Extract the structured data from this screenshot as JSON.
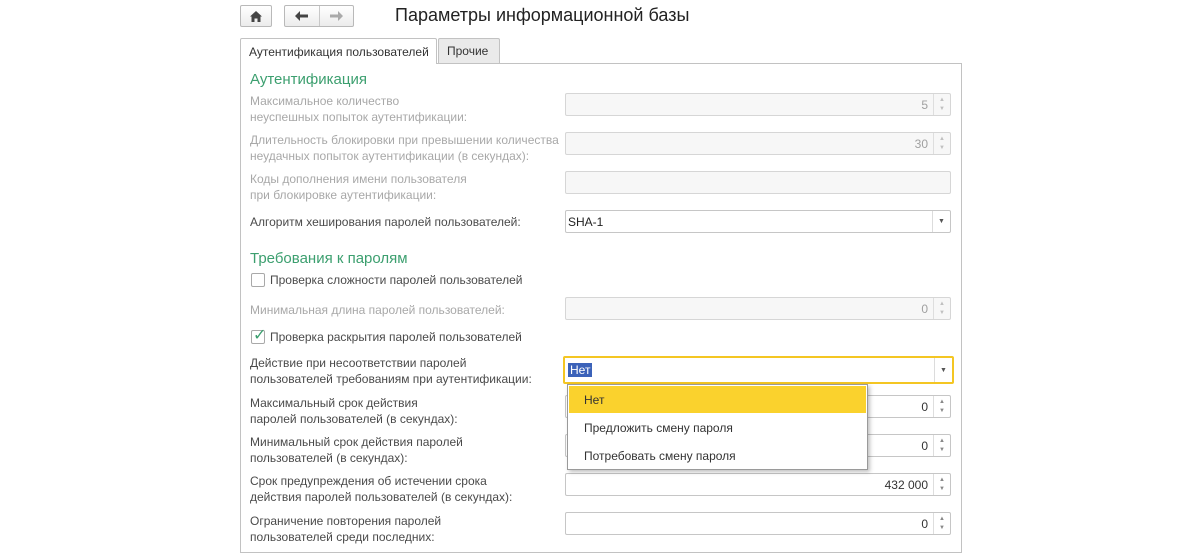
{
  "toolbar": {
    "home_icon": "home-icon",
    "back_icon": "arrow-left-icon",
    "forward_icon": "arrow-right-icon",
    "title": "Параметры информационной базы"
  },
  "tabs": [
    {
      "label": "Аутентификация пользователей",
      "active": true
    },
    {
      "label": "Прочие",
      "active": false
    }
  ],
  "auth_section": {
    "heading": "Аутентификация",
    "max_failed": {
      "label1": "Максимальное количество",
      "label2": "неуспешных попыток аутентификации:",
      "value": "5"
    },
    "lock_duration": {
      "label1": "Длительность блокировки при превышении количества",
      "label2": "неудачных попыток аутентификации (в секундах):",
      "value": "30"
    },
    "name_codes": {
      "label1": "Коды дополнения имени пользователя",
      "label2": "при блокировке аутентификации:",
      "value": ""
    },
    "hash_algo": {
      "label": "Алгоритм хеширования паролей пользователей:",
      "value": "SHA-1"
    }
  },
  "password_section": {
    "heading": "Требования к паролям",
    "complexity_check": {
      "label": "Проверка сложности паролей пользователей",
      "checked": false
    },
    "min_length": {
      "label": "Минимальная длина паролей пользователей:",
      "value": "0"
    },
    "disclosure_check": {
      "label": "Проверка раскрытия паролей пользователей",
      "checked": true
    },
    "mismatch_action": {
      "label1": "Действие при несоответствии паролей",
      "label2": "пользователей требованиям при аутентификации:",
      "value": "Нет"
    },
    "max_age": {
      "label1": "Максимальный срок действия",
      "label2": "паролей пользователей (в секундах):",
      "value": "0"
    },
    "min_age": {
      "label1": "Минимальный срок действия паролей",
      "label2": "пользователей (в секундах):",
      "value": "0"
    },
    "warning": {
      "label1": "Срок предупреждения об истечении срока",
      "label2": "действия паролей пользователей (в секундах):",
      "value": "432 000"
    },
    "reuse_limit": {
      "label1": "Ограничение повторения паролей",
      "label2": "пользователей среди последних:",
      "value": "0"
    }
  },
  "dropdown_options": [
    {
      "label": "Нет",
      "selected": true
    },
    {
      "label": "Предложить смену пароля",
      "selected": false
    },
    {
      "label": "Потребовать смену пароля",
      "selected": false
    }
  ],
  "colors": {
    "accent_green": "#3c9f6f",
    "focus_yellow": "#f4c623",
    "selected_option": "#fad22d",
    "text_selection": "#3b62b9"
  }
}
